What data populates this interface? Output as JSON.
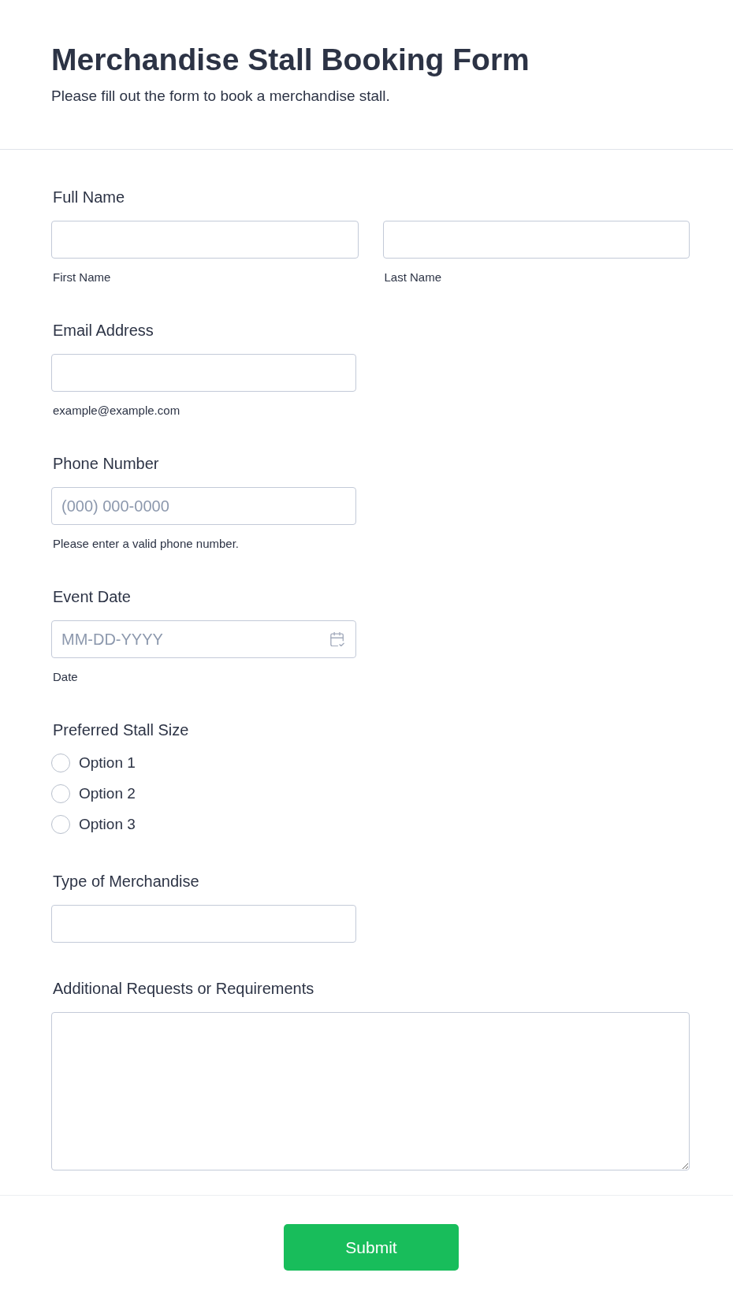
{
  "header": {
    "title": "Merchandise Stall Booking Form",
    "subtitle": "Please fill out the form to book a merchandise stall."
  },
  "fields": [
    {
      "kind": "name",
      "label": "Full Name",
      "parts": [
        {
          "sublabel": "First Name"
        },
        {
          "sublabel": "Last Name"
        }
      ]
    },
    {
      "kind": "text",
      "label": "Email Address",
      "sublabel": "example@example.com"
    },
    {
      "kind": "text",
      "label": "Phone Number",
      "placeholder": "(000) 000-0000",
      "sublabel": "Please enter a valid phone number."
    },
    {
      "kind": "date",
      "label": "Event Date",
      "placeholder": "MM-DD-YYYY",
      "sublabel": "Date"
    },
    {
      "kind": "radio",
      "label": "Preferred Stall Size",
      "options": [
        {
          "label": "Option 1",
          "selected": false
        },
        {
          "label": "Option 2",
          "selected": false
        },
        {
          "label": "Option 3",
          "selected": false
        }
      ]
    },
    {
      "kind": "text",
      "label": "Type of Merchandise"
    },
    {
      "kind": "textarea",
      "label": "Additional Requests or Requirements"
    }
  ],
  "submit": {
    "label": "Submit"
  }
}
